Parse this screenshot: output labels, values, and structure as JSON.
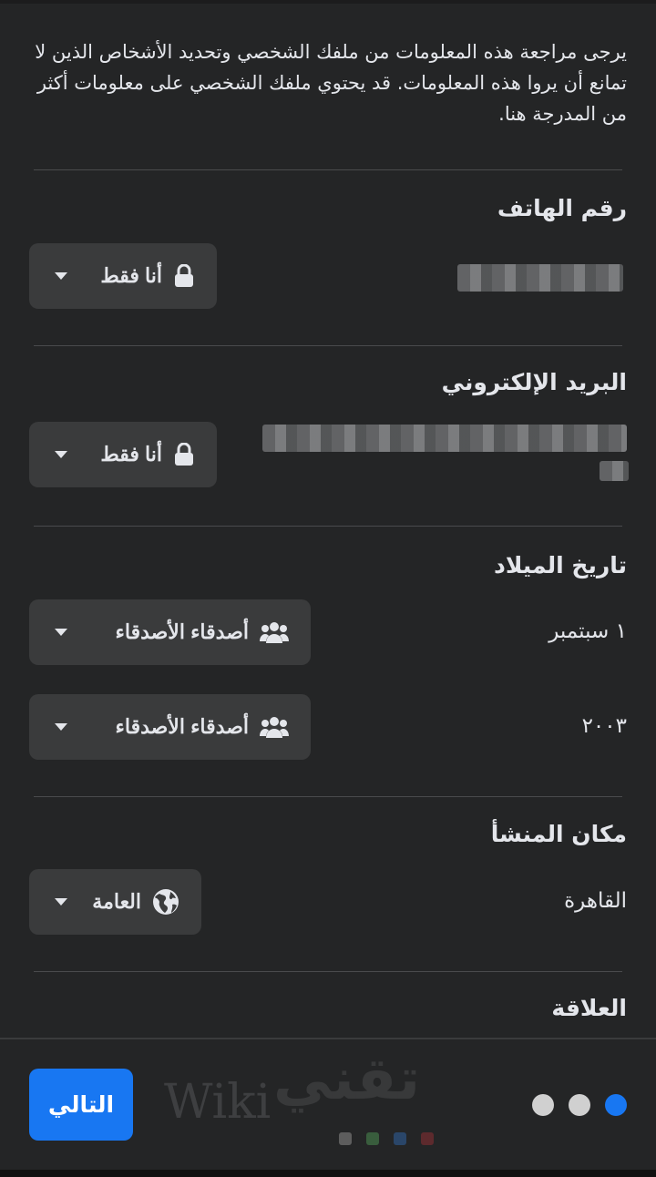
{
  "intro_text": "يرجى مراجعة هذه المعلومات من ملفك الشخصي وتحديد الأشخاص الذين لا تمانع أن يروا هذه المعلومات. قد يحتوي ملفك الشخصي على معلومات أكثر من المدرجة هنا.",
  "sections": {
    "phone": {
      "title": "رقم الهاتف",
      "privacy": "أنا فقط",
      "privacy_icon": "lock-icon"
    },
    "email": {
      "title": "البريد الإلكتروني",
      "privacy": "أنا فقط",
      "privacy_icon": "lock-icon"
    },
    "birthday": {
      "title": "تاريخ الميلاد",
      "day_month": "١ سبتمبر",
      "day_month_privacy": "أصدقاء الأصدقاء",
      "year": "٢٠٠٣",
      "year_privacy": "أصدقاء الأصدقاء",
      "privacy_icon": "friends-icon"
    },
    "hometown": {
      "title": "مكان المنشأ",
      "value": "القاهرة",
      "privacy": "العامة",
      "privacy_icon": "globe-icon"
    },
    "relationship": {
      "title": "العلاقة"
    }
  },
  "footer": {
    "next_label": "التالي",
    "pagination": {
      "total": 3,
      "current": 1
    }
  },
  "watermark": {
    "latin": "Wiki",
    "arabic": "تقني"
  },
  "colors": {
    "background": "#242526",
    "button": "#3a3b3c",
    "accent": "#1877f2",
    "dot_inactive": "#d0d0d0"
  }
}
